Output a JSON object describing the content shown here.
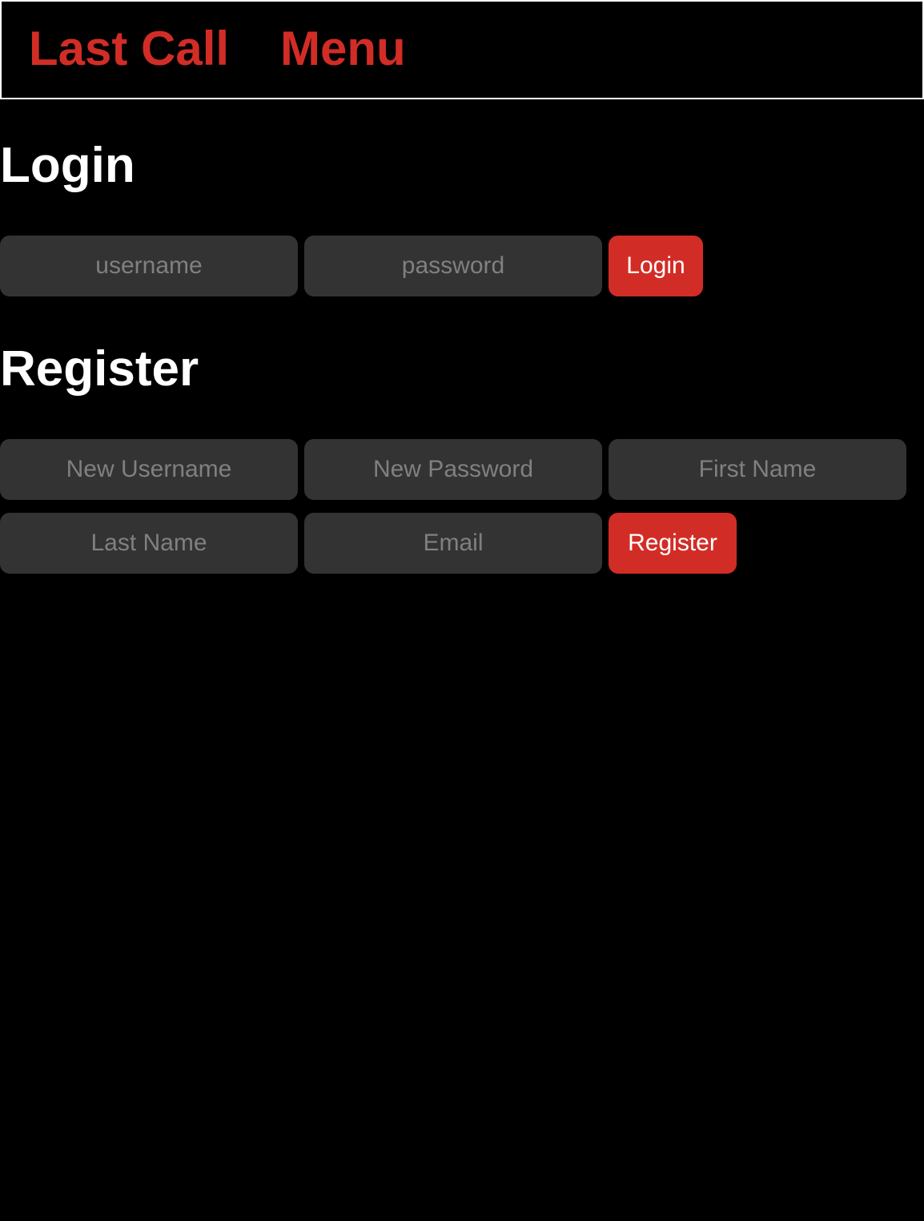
{
  "nav": {
    "brand": "Last Call",
    "menu": "Menu"
  },
  "login": {
    "title": "Login",
    "username_placeholder": "username",
    "password_placeholder": "password",
    "button_label": "Login"
  },
  "register": {
    "title": "Register",
    "new_username_placeholder": "New Username",
    "new_password_placeholder": "New Password",
    "first_name_placeholder": "First Name",
    "last_name_placeholder": "Last Name",
    "email_placeholder": "Email",
    "button_label": "Register"
  },
  "colors": {
    "accent": "#d12d26",
    "background": "#000000",
    "field": "#333333",
    "placeholder": "#808080",
    "text": "#ffffff"
  }
}
